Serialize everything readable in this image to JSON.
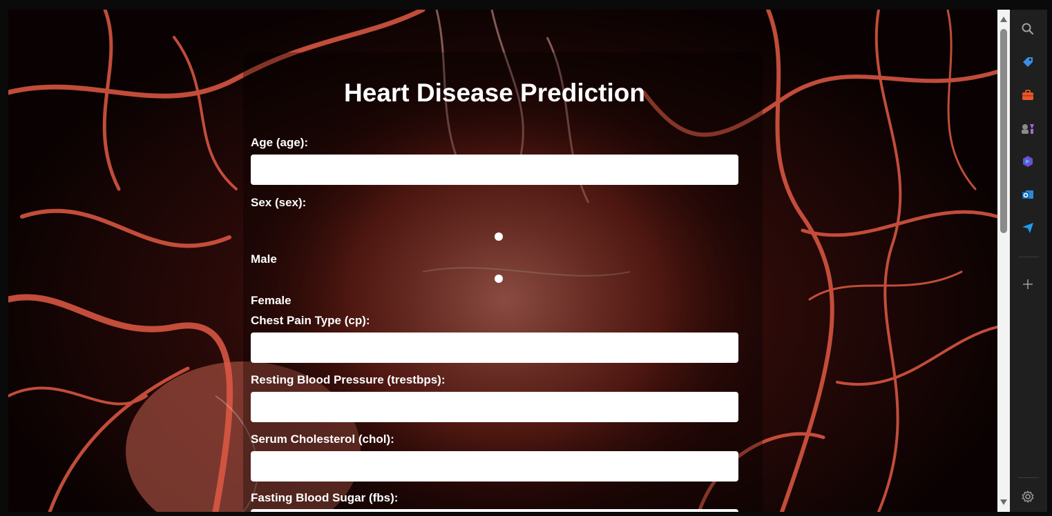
{
  "page": {
    "title": "Heart Disease Prediction"
  },
  "form": {
    "age_label": "Age (age):",
    "sex_label": "Sex (sex):",
    "sex_options": [
      "Male",
      "Female"
    ],
    "cp_label": "Chest Pain Type (cp):",
    "trestbps_label": "Resting Blood Pressure (trestbps):",
    "chol_label": "Serum Cholesterol (chol):",
    "fbs_label": "Fasting Blood Sugar (fbs):",
    "age_value": "",
    "cp_value": "",
    "trestbps_value": "",
    "chol_value": ""
  },
  "sidebar": {
    "icons": [
      "search-icon",
      "tag-icon",
      "briefcase-icon",
      "games-icon",
      "copilot-icon",
      "outlook-icon",
      "send-icon",
      "add-icon",
      "settings-icon"
    ]
  },
  "colors": {
    "background_accent": "#c0392b",
    "sidebar_bg": "#1f1f1f",
    "outlook_blue": "#0f6cbd",
    "copilot_purple": "#6b4fd8",
    "send_blue": "#1d9bf0"
  }
}
